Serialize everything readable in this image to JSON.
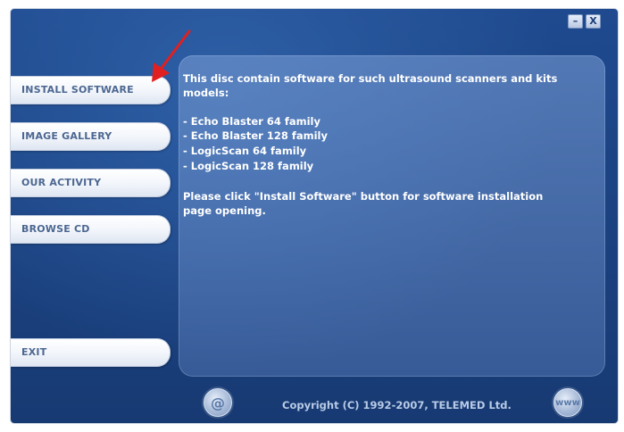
{
  "window": {
    "min_glyph": "–",
    "close_glyph": "X"
  },
  "nav": [
    {
      "label": "INSTALL SOFTWARE"
    },
    {
      "label": "IMAGE GALLERY"
    },
    {
      "label": "OUR ACTIVITY"
    },
    {
      "label": "BROWSE CD"
    },
    {
      "label": "EXIT"
    }
  ],
  "content": {
    "intro": "This disc contain software for such ultrasound scanners and kits",
    "intro2": "models:",
    "models": [
      "- Echo Blaster 64 family",
      "- Echo Blaster 128 family",
      "- LogicScan 64 family",
      "- LogicScan 128 family"
    ],
    "note": "Please click \"Install Software\" button for software installation",
    "note2": "page opening."
  },
  "footer": {
    "copyright": "Copyright (C) 1992-2007, TELEMED Ltd.",
    "email_glyph": "@",
    "web_glyph": "www"
  },
  "colors": {
    "background": "#1b417f",
    "annotation_arrow": "#e02020"
  }
}
